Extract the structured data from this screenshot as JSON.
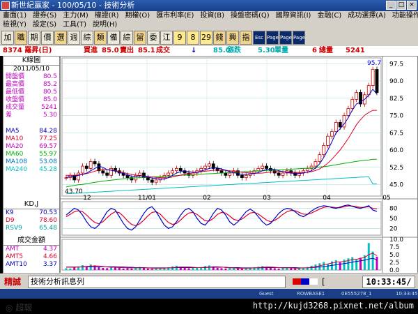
{
  "window": {
    "title": "新世紀贏家 - 100/05/10 - 技術分析",
    "min": "_",
    "max": "□",
    "close": "×"
  },
  "menu": {
    "row1": [
      "畫面(1)",
      "證券(S)",
      "主力(M)",
      "權證(R)",
      "期權(O)",
      "匯市利率(E)",
      "投資(B)",
      "操盤密碼(Q)",
      "國際資訊(I)",
      "金融(C)",
      "成功選擇(A)",
      "功能操作(E)"
    ],
    "row2": [
      "檢視(Y)",
      "設定(S)",
      "工具(T)",
      "說明(H)"
    ]
  },
  "toolbar": {
    "chars": [
      "加",
      "職",
      "期",
      "價",
      "選",
      "週",
      "綜",
      "類",
      "備",
      "綜",
      "留",
      "委",
      "江"
    ],
    "nums": [
      "9",
      "8",
      "29"
    ],
    "chars2": [
      "錢",
      "興",
      "指"
    ],
    "icons": [
      "Esc",
      "Page Up",
      "Page Down",
      "Page Size"
    ]
  },
  "quote": {
    "stock": "8374 羅昇(日)",
    "bid_label": "買進",
    "bid": "85.0",
    "ask_label": "賣出",
    "ask": "85.1",
    "last_label": "成交",
    "arrow": "↓",
    "last": "85.0",
    "change_label": "漲跌",
    "change": "5.30",
    "vol_label": "單量",
    "vol": "6",
    "totvol_label": "總量",
    "totvol": "5241"
  },
  "kpanel": {
    "title": "K線圖",
    "date": "2011/05/10",
    "rows": [
      {
        "k": "開盤價",
        "v": "80.5"
      },
      {
        "k": "最高價",
        "v": "85.2"
      },
      {
        "k": "最低價",
        "v": "80.5"
      },
      {
        "k": "收盤價",
        "v": "85.0"
      },
      {
        "k": "成交量",
        "v": "5241"
      },
      {
        "k": "差",
        "v": "5.30"
      }
    ],
    "ma": [
      {
        "k": "MA5",
        "v": "84.28",
        "color": "#0000c0"
      },
      {
        "k": "MA10",
        "v": "77.25",
        "color": "#e0002a"
      },
      {
        "k": "MA20",
        "v": "69.57",
        "color": "#c000c0"
      },
      {
        "k": "MA60",
        "v": "55.97",
        "color": "#00b000"
      },
      {
        "k": "MA108",
        "v": "53.08",
        "color": "#0070c0"
      },
      {
        "k": "MA240",
        "v": "45.28",
        "color": "#00c0c0"
      }
    ]
  },
  "kd_panel": {
    "title": "KD,J",
    "rows": [
      {
        "k": "K9",
        "v": "70.53",
        "color": "#0000c0"
      },
      {
        "k": "D9",
        "v": "78.60",
        "color": "#e0002a"
      },
      {
        "k": "RSV9",
        "v": "65.48",
        "color": "#00a0a0"
      }
    ]
  },
  "amt_panel": {
    "title": "成交金額",
    "rows": [
      {
        "k": "AMT",
        "v": "4.37",
        "color": "#c000c0"
      },
      {
        "k": "AMT5",
        "v": "4.66",
        "color": "#e0002a"
      },
      {
        "k": "AMT10",
        "v": "3.37",
        "color": "#0000c0"
      }
    ]
  },
  "chart_data": {
    "type": "candlestick",
    "price": {
      "ylim": [
        40,
        100
      ],
      "yticks": [
        "97.5",
        "90.0",
        "82.5",
        "75.0",
        "67.5",
        "60.0",
        "52.5",
        "45.0"
      ],
      "high_label": "95.7",
      "low_label": "43.70",
      "xticks": [
        "12",
        "11/01",
        "02",
        "03",
        "04",
        "05"
      ],
      "close": [
        48,
        49,
        47,
        50,
        53,
        52,
        55,
        54,
        51,
        50,
        49,
        52,
        51,
        50,
        49,
        48,
        47,
        49,
        50,
        48,
        47,
        46,
        47,
        48,
        49,
        50,
        51,
        52,
        51,
        50,
        49,
        50,
        51,
        52,
        53,
        54,
        52,
        51,
        50,
        49,
        50,
        51,
        49,
        48,
        49,
        50,
        51,
        52,
        53,
        52,
        51,
        50,
        49,
        50,
        51,
        50,
        49,
        50,
        51,
        52,
        53,
        55,
        58,
        62,
        66,
        68,
        72,
        70,
        75,
        78,
        82,
        85,
        80,
        84,
        88,
        95,
        85
      ],
      "ma5": [
        48,
        48.5,
        48.6,
        49,
        49.4,
        50,
        51,
        52,
        53,
        52.5,
        51.5,
        51.2,
        50.8,
        50.2,
        49.8,
        49.2,
        48.6,
        48.6,
        48.8,
        48.6,
        48.2,
        47.8,
        47.6,
        47.4,
        47.4,
        48,
        49,
        50,
        50.6,
        50.8,
        50.6,
        50.4,
        50.4,
        50.8,
        51.4,
        52,
        52.4,
        52.2,
        51.8,
        51.2,
        50.6,
        50.2,
        49.8,
        49.4,
        49.4,
        49.6,
        49.8,
        50.2,
        51,
        51.6,
        51.8,
        51.6,
        51,
        50.6,
        50.2,
        50,
        49.8,
        49.8,
        50,
        50.4,
        51,
        52.2,
        54,
        56.8,
        60,
        63.6,
        67.4,
        69.2,
        71.4,
        74,
        77.4,
        80,
        80.8,
        82,
        83.8,
        86.4,
        84.28
      ],
      "ma10": [
        49,
        49,
        49,
        49.2,
        49.4,
        49.8,
        50.2,
        50.8,
        51.3,
        51.6,
        51.5,
        51.3,
        51,
        50.6,
        50.2,
        49.8,
        49.4,
        49.1,
        48.9,
        48.7,
        48.5,
        48.3,
        48.1,
        48,
        47.9,
        48,
        48.3,
        48.7,
        49.1,
        49.5,
        49.8,
        50.1,
        50.4,
        50.6,
        50.8,
        51,
        51.2,
        51.3,
        51.3,
        51.2,
        51,
        50.8,
        50.6,
        50.4,
        50.2,
        50,
        49.9,
        49.9,
        50,
        50.2,
        50.4,
        50.6,
        50.6,
        50.6,
        50.5,
        50.4,
        50.3,
        50.2,
        50.2,
        50.3,
        50.6,
        51.1,
        51.8,
        52.9,
        54.3,
        56,
        58,
        60,
        62.5,
        65,
        68,
        71,
        73.2,
        75.1,
        76.3,
        77.25,
        77.25
      ],
      "ma60": [
        44,
        44.3,
        44.6,
        44.9,
        45.1,
        45.4,
        45.7,
        46,
        46.2,
        46.5,
        46.7,
        46.9,
        47.1,
        47.3,
        47.5,
        47.6,
        47.8,
        47.9,
        48,
        48.1,
        48.2,
        48.3,
        48.4,
        48.5,
        48.6,
        48.7,
        48.8,
        48.9,
        49,
        49.1,
        49.2,
        49.3,
        49.4,
        49.5,
        49.6,
        49.7,
        49.8,
        49.9,
        50,
        50.1,
        50.2,
        50.3,
        50.4,
        50.5,
        50.6,
        50.7,
        50.8,
        50.9,
        51,
        51.1,
        51.2,
        51.3,
        51.4,
        51.5,
        51.6,
        51.7,
        51.8,
        51.9,
        52,
        52.1,
        52.2,
        52.4,
        52.6,
        52.8,
        53,
        53.3,
        53.6,
        53.9,
        54.2,
        54.5,
        54.8,
        55.1,
        55.3,
        55.5,
        55.7,
        55.97,
        55.97
      ],
      "ma240": [
        41,
        41.1,
        41.2,
        41.3,
        41.4,
        41.5,
        41.6,
        41.7,
        41.8,
        41.9,
        42,
        42.1,
        42.2,
        42.3,
        42.4,
        42.5,
        42.6,
        42.7,
        42.8,
        42.9,
        43,
        43.1,
        43.2,
        43.3,
        43.4,
        43.5,
        43.6,
        43.7,
        43.8,
        43.9,
        44,
        44.1,
        44.2,
        44.3,
        44.4,
        44.5,
        44.6,
        44.7,
        44.8,
        44.9,
        45,
        45.1,
        45.2,
        45.3,
        45.4,
        45.5,
        45.6,
        45.7,
        45.8,
        45.9,
        46,
        46.1,
        46.2,
        46.3,
        46.4,
        46.5,
        46.6,
        46.7,
        46.8,
        46.9,
        47,
        47.1,
        47.2,
        47.3,
        47.4,
        47.5,
        47.6,
        47.7,
        47.8,
        47.9,
        48,
        48.1,
        48.2,
        48.3,
        48.4,
        45.28,
        45.28
      ]
    },
    "kd": {
      "ylim": [
        0,
        100
      ],
      "yticks": [
        "80",
        "50",
        "20"
      ],
      "k": [
        60,
        70,
        80,
        75,
        60,
        40,
        25,
        20,
        30,
        50,
        70,
        80,
        75,
        55,
        35,
        20,
        15,
        25,
        45,
        65,
        80,
        85,
        70,
        50,
        30,
        20,
        25,
        40,
        60,
        75,
        80,
        70,
        50,
        35,
        30,
        45,
        65,
        80,
        75,
        60,
        40,
        30,
        40,
        55,
        70,
        78,
        70,
        55,
        40,
        30,
        35,
        50,
        65,
        75,
        80,
        78,
        70,
        60,
        55,
        62,
        72,
        80,
        85,
        88,
        86,
        82,
        80,
        84,
        88,
        90,
        86,
        82,
        80,
        84,
        88,
        75,
        70.53
      ],
      "d": [
        55,
        62,
        70,
        73,
        70,
        60,
        48,
        38,
        34,
        40,
        52,
        63,
        70,
        67,
        56,
        43,
        32,
        28,
        34,
        45,
        58,
        68,
        70,
        63,
        50,
        38,
        32,
        35,
        45,
        57,
        66,
        68,
        62,
        52,
        43,
        42,
        50,
        62,
        68,
        66,
        57,
        47,
        44,
        48,
        57,
        66,
        68,
        63,
        54,
        45,
        40,
        44,
        52,
        62,
        70,
        74,
        73,
        68,
        63,
        62,
        66,
        72,
        78,
        83,
        85,
        84,
        82,
        82,
        85,
        87,
        87,
        85,
        83,
        83,
        85,
        80,
        78.6
      ]
    },
    "amount": {
      "ylim": [
        0,
        10
      ],
      "yticks": [
        "10.0",
        "7.5",
        "5.0",
        "2.5",
        "0.0"
      ],
      "values": [
        0.6,
        0.5,
        0.8,
        1.2,
        1.6,
        1.0,
        1.8,
        1.5,
        0.9,
        0.7,
        0.6,
        1.1,
        0.9,
        0.7,
        0.5,
        0.6,
        0.5,
        0.8,
        1.0,
        0.7,
        0.5,
        0.4,
        0.6,
        0.7,
        0.8,
        0.9,
        1.2,
        1.4,
        1.1,
        0.8,
        0.6,
        0.7,
        0.9,
        1.0,
        1.3,
        1.5,
        0.9,
        0.7,
        0.6,
        0.5,
        0.6,
        0.8,
        0.6,
        0.5,
        0.6,
        0.7,
        0.9,
        1.1,
        1.3,
        1.0,
        0.8,
        0.6,
        0.5,
        0.7,
        0.8,
        0.6,
        0.5,
        0.6,
        0.8,
        1.0,
        1.4,
        1.8,
        2.2,
        2.6,
        2.0,
        2.8,
        3.2,
        2.5,
        3.4,
        3.8,
        4.2,
        3.5,
        4.0,
        4.8,
        8.8,
        6.0,
        4.37
      ],
      "amt5": [
        0.9,
        0.9,
        0.9,
        1.0,
        1.1,
        1.2,
        1.3,
        1.3,
        1.3,
        1.2,
        1.0,
        0.9,
        0.9,
        0.8,
        0.8,
        0.7,
        0.7,
        0.7,
        0.7,
        0.7,
        0.7,
        0.6,
        0.6,
        0.6,
        0.6,
        0.7,
        0.8,
        0.9,
        1.0,
        1.0,
        1.0,
        0.9,
        0.8,
        0.8,
        0.9,
        1.0,
        1.1,
        1.1,
        1.0,
        0.8,
        0.7,
        0.7,
        0.6,
        0.6,
        0.6,
        0.6,
        0.7,
        0.8,
        0.9,
        1.0,
        1.0,
        0.9,
        0.8,
        0.7,
        0.7,
        0.7,
        0.6,
        0.6,
        0.7,
        0.7,
        0.9,
        1.1,
        1.4,
        1.7,
        2.0,
        2.3,
        2.6,
        2.7,
        2.8,
        3.1,
        3.4,
        3.5,
        3.8,
        4.1,
        5.0,
        5.5,
        4.66
      ],
      "amt10": [
        1.0,
        1.0,
        1.0,
        1.0,
        1.0,
        1.1,
        1.1,
        1.1,
        1.1,
        1.1,
        1.1,
        1.1,
        1.1,
        1.0,
        1.0,
        0.9,
        0.9,
        0.8,
        0.8,
        0.8,
        0.7,
        0.7,
        0.7,
        0.7,
        0.7,
        0.7,
        0.7,
        0.8,
        0.8,
        0.8,
        0.8,
        0.8,
        0.8,
        0.8,
        0.8,
        0.9,
        0.9,
        0.9,
        0.9,
        0.9,
        0.8,
        0.8,
        0.8,
        0.7,
        0.7,
        0.7,
        0.7,
        0.7,
        0.7,
        0.8,
        0.8,
        0.8,
        0.8,
        0.8,
        0.8,
        0.8,
        0.8,
        0.7,
        0.7,
        0.7,
        0.8,
        0.9,
        1.0,
        1.1,
        1.3,
        1.5,
        1.7,
        1.9,
        2.1,
        2.3,
        2.6,
        2.8,
        3.0,
        3.2,
        3.6,
        3.8,
        3.37
      ]
    }
  },
  "status": {
    "brand": "精誠",
    "message": "技術分析訊息列",
    "bracket": "[",
    "clock": "10:33:45",
    "clock_sep": "/"
  },
  "taskbar": [
    "Guest",
    "ROWBASE1",
    "0E555278_1",
    "10:33:45"
  ],
  "watermark": "http://kujd3268.pixnet.net/album"
}
